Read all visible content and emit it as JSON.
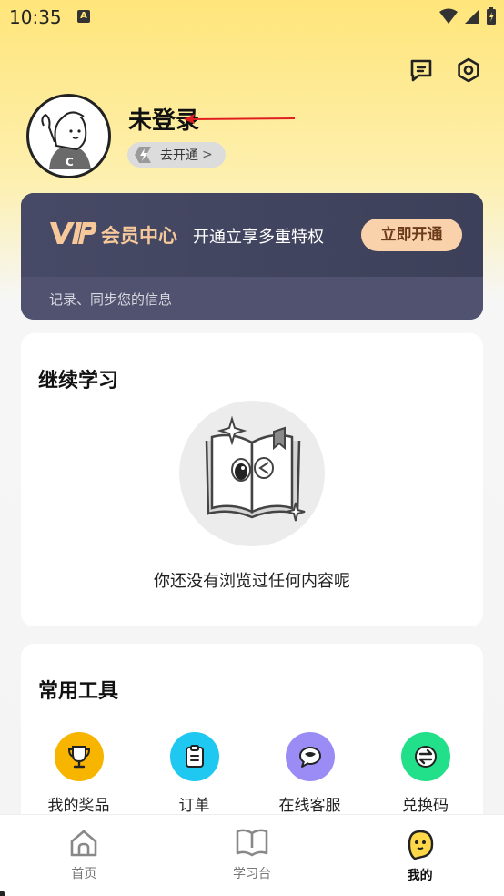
{
  "status_bar": {
    "time": "10:35",
    "notification_badge": "A"
  },
  "header": {
    "icons": [
      "feedback-icon",
      "settings-icon"
    ]
  },
  "profile": {
    "username": "未登录",
    "badge_label": "去开通",
    "badge_chevron": ">"
  },
  "vip": {
    "logo_text": "VIP",
    "title": "会员中心",
    "description": "开通立享多重特权",
    "button_label": "立即开通",
    "note": "记录、同步您的信息",
    "colors": {
      "accent": "#f6c89a",
      "button_bg": "#f9d2ab",
      "card_bg": "#424460"
    }
  },
  "continue_learning": {
    "title": "继续学习",
    "empty_text": "你还没有浏览过任何内容呢"
  },
  "tools": {
    "title": "常用工具",
    "items": [
      {
        "label": "我的奖品",
        "icon": "trophy-icon",
        "color": "#f7b500"
      },
      {
        "label": "订单",
        "icon": "clipboard-icon",
        "color": "#1ec8f0"
      },
      {
        "label": "在线客服",
        "icon": "chat-bubble-icon",
        "color": "#9b8cf5"
      },
      {
        "label": "兑换码",
        "icon": "exchange-icon",
        "color": "#22e089"
      }
    ]
  },
  "tabbar": {
    "items": [
      {
        "label": "首页",
        "icon": "home-icon",
        "active": false
      },
      {
        "label": "学习台",
        "icon": "book-icon",
        "active": false
      },
      {
        "label": "我的",
        "icon": "mascot-face-icon",
        "active": true
      }
    ]
  }
}
